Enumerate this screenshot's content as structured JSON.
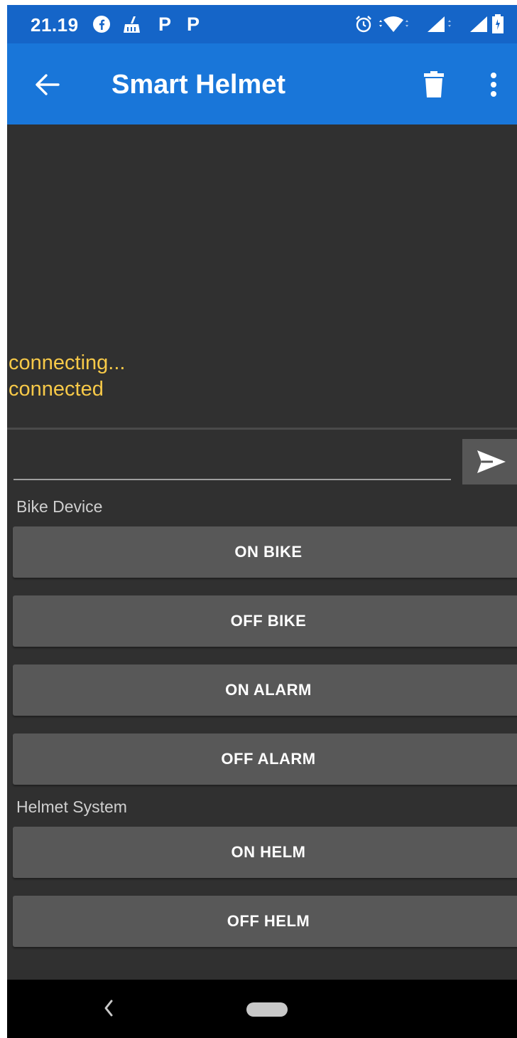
{
  "status_bar": {
    "time": "21.19",
    "notification_icons": [
      "facebook-icon",
      "cleaner-icon",
      "p-letter-icon",
      "p-letter-icon"
    ],
    "p_letter": "P",
    "system_icons": [
      "alarm-icon",
      "wifi-icon",
      "signal-icon",
      "signal-icon",
      "battery-icon"
    ]
  },
  "app_bar": {
    "title": "Smart Helmet",
    "back_icon": "arrow-left-icon",
    "delete_icon": "trash-icon",
    "more_icon": "more-vertical-icon"
  },
  "terminal": {
    "lines": [
      "connecting...",
      "connected"
    ],
    "text_color": "#f7c948"
  },
  "input": {
    "value": "",
    "placeholder": "",
    "send_icon": "send-icon"
  },
  "sections": [
    {
      "label": "Bike Device",
      "buttons": [
        "ON BIKE",
        "OFF BIKE",
        "ON ALARM",
        "OFF ALARM"
      ]
    },
    {
      "label": "Helmet System",
      "buttons": [
        "ON HELM",
        "OFF HELM"
      ]
    }
  ],
  "nav_bar": {
    "back_icon": "chevron-left-icon",
    "home_icon": "home-pill-icon"
  },
  "colors": {
    "app_bar": "#1976d9",
    "status_bar": "#1565c8",
    "background": "#303030",
    "button": "#585858"
  }
}
